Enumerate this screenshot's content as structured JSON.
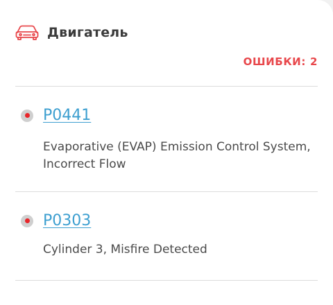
{
  "section": {
    "title": "Двигатель",
    "icon": "car-icon",
    "accent_color": "#e8474b"
  },
  "errors": {
    "label": "ОШИБКИ:",
    "count": "2"
  },
  "codes": [
    {
      "code": "P0441",
      "description": "Evaporative (EVAP) Emission Control System, Incorrect Flow"
    },
    {
      "code": "P0303",
      "description": "Cylinder 3, Misfire Detected"
    }
  ],
  "colors": {
    "link": "#3d9fd0",
    "status_dot": "#e8262b"
  }
}
